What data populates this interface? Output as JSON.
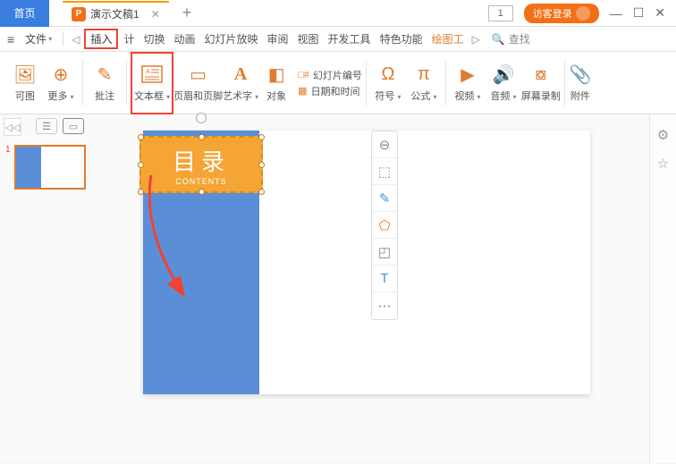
{
  "titlebar": {
    "home_label": "首页",
    "doc_title": "演示文稿1",
    "page_indicator": "1",
    "login_label": "访客登录"
  },
  "menubar": {
    "file": "文件",
    "items": [
      "插入",
      "计",
      "切换",
      "动画",
      "幻灯片放映",
      "审阅",
      "视图",
      "开发工具",
      "特色功能",
      "绘图工"
    ],
    "search": "查找"
  },
  "ribbon": {
    "ketu": "可图",
    "more": "更多",
    "pizhu": "批注",
    "textbox": "文本框",
    "header_footer": "页眉和页脚",
    "wordart": "艺术字",
    "object": "对象",
    "slide_number": "幻灯片编号",
    "datetime": "日期和时间",
    "symbol": "符号",
    "formula": "公式",
    "video": "视频",
    "audio": "音频",
    "screen_record": "屏幕录制",
    "attach": "附件"
  },
  "thumbnails": {
    "num1": "1"
  },
  "slide": {
    "title": "目录",
    "subtitle": "CONTENTS"
  }
}
